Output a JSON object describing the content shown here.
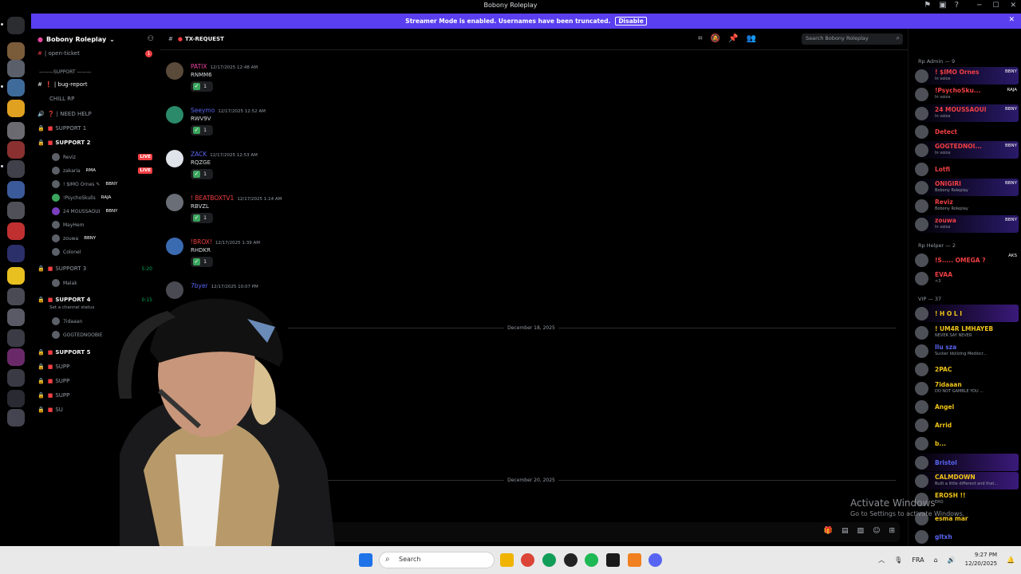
{
  "window": {
    "title": "Bobony Roleplay"
  },
  "banner": {
    "text": "Streamer Mode is enabled. Usernames have been truncated.",
    "disable_label": "Disable"
  },
  "server": {
    "name": "Bobony Roleplay"
  },
  "sidebar": {
    "channels": [
      {
        "label": "| open-ticket",
        "badge": "1"
      },
      {
        "label": "———SUPPORT ———",
        "category": true
      },
      {
        "label": "❗ | bug-report"
      },
      {
        "label": "CHILL RP"
      },
      {
        "label": "❓ | NEED HELP"
      },
      {
        "label": "SUPPORT 1"
      },
      {
        "label": "SUPPORT 2"
      },
      {
        "label": "SUPPORT 3",
        "timer": "5:20"
      },
      {
        "label": "SUPPORT 4",
        "timer": "0:15",
        "status": "Set a channel status"
      }
    ],
    "voice_support2": [
      {
        "name": "Reviz",
        "live": "LIVE"
      },
      {
        "name": "zakaria",
        "tag": "RMA",
        "live": "LIVE"
      },
      {
        "name": "! $IMO Ornes ✎",
        "tag": "BBNY"
      },
      {
        "name": "!PsychoSkulls",
        "tag": "RAJA"
      },
      {
        "name": "24 MOUSSAOUI",
        "tag": "BBNY"
      },
      {
        "name": "MayHem"
      },
      {
        "name": "zouwa",
        "tag": "BBNY"
      },
      {
        "name": "Colonel"
      }
    ],
    "voice_support3": [
      {
        "name": "Malak"
      }
    ],
    "voice_support4": [
      {
        "name": "7idaaan"
      },
      {
        "name": "GOGTEDNOOBIE"
      }
    ],
    "more_channels": [
      "SUPPORT 5",
      "SUPP",
      "SUPP",
      "SUPP",
      "SU"
    ]
  },
  "channel": {
    "name": "TX-REQUEST"
  },
  "search": {
    "placeholder": "Search Bobony Roleplay"
  },
  "messages": [
    {
      "user": "PATIX",
      "time": "12/17/2025 12:48 AM",
      "text": "RNMM6",
      "reaction_count": "1"
    },
    {
      "user": "Seeymo",
      "time": "12/17/2025 12:52 AM",
      "text": "RWV9V",
      "reaction_count": "1"
    },
    {
      "user": "ZACK",
      "time": "12/17/2025 12:53 AM",
      "text": "RQZGE",
      "reaction_count": "1"
    },
    {
      "user": "! BEATBOXTV1",
      "time": "12/17/2025 1:14 AM",
      "text": "RBVZL",
      "reaction_count": "1"
    },
    {
      "user": "!BROX!",
      "time": "12/17/2025 1:39 AM",
      "text": "RHDKR",
      "reaction_count": "1"
    },
    {
      "user": "7byer",
      "time": "12/17/2025 10:07 PM",
      "text": "",
      "reaction_count": ""
    }
  ],
  "dividers": [
    "December 18, 2025",
    "December 20, 2025"
  ],
  "members": {
    "groups": [
      {
        "header": "Rp Admin — 9",
        "items": [
          {
            "name": "! $IMO Ornes",
            "status": "In voice",
            "tag": "BBNY",
            "color": "#f23f43"
          },
          {
            "name": "!PsychoSku...",
            "status": "In voice",
            "tag": "RAJA",
            "color": "#f23f43"
          },
          {
            "name": "24 MOUSSAOUI",
            "status": "In voice",
            "tag": "BBNY",
            "color": "#f23f43"
          },
          {
            "name": "Detect",
            "status": "",
            "tag": "",
            "color": "#f23f43"
          },
          {
            "name": "GOGTEDNOI...",
            "status": "In voice",
            "tag": "BBNY",
            "color": "#f23f43"
          },
          {
            "name": "Lotfi",
            "status": "",
            "tag": "",
            "color": "#f23f43"
          },
          {
            "name": "ONIGIRI",
            "status": "Bobony Roleplay",
            "tag": "BBNY",
            "color": "#f23f43"
          },
          {
            "name": "Reviz",
            "status": "Bobony Roleplay",
            "tag": "",
            "color": "#f23f43"
          },
          {
            "name": "zouwa",
            "status": "In voice",
            "tag": "BBNY",
            "color": "#f23f43"
          }
        ]
      },
      {
        "header": "Rp Helper — 2",
        "items": [
          {
            "name": "!S..... OMEGA ?",
            "status": "",
            "tag": "AKS",
            "color": "#f23f43"
          },
          {
            "name": "EVAA",
            "status": "<3",
            "tag": "",
            "color": "#f23f43"
          }
        ]
      },
      {
        "header": "VIP — 37",
        "items": [
          {
            "name": "! H O L I",
            "status": "",
            "tag": "",
            "color": "#f0c419"
          },
          {
            "name": "! UM4R LMHAYEB",
            "status": "NEVER SAY NEVER",
            "tag": "",
            "color": "#f0c419"
          },
          {
            "name": "Ilu sza",
            "status": "Sucker Idolizing Mediocr...",
            "tag": "",
            "color": "#5865f2"
          },
          {
            "name": "2PAC",
            "status": "",
            "tag": "",
            "color": "#f0c419"
          },
          {
            "name": "7idaaan",
            "status": "DO NOT GAMBLE YOU ...",
            "tag": "",
            "color": "#f0c419"
          },
          {
            "name": "Angel",
            "status": "",
            "tag": "",
            "color": "#f0c419"
          },
          {
            "name": "Arrid",
            "status": "",
            "tag": "",
            "color": "#f0c419"
          },
          {
            "name": "b...",
            "status": "",
            "tag": "",
            "color": "#f0c419"
          },
          {
            "name": "Bristol",
            "status": "",
            "tag": "",
            "color": "#5865f2"
          },
          {
            "name": "CALMDOWN",
            "status": "Built a little different and that...",
            "tag": "",
            "color": "#f0c419"
          },
          {
            "name": "EROSH !!",
            "status": "ERO",
            "tag": "",
            "color": "#f0c419"
          },
          {
            "name": "esma mar",
            "status": "",
            "tag": "",
            "color": "#f0c419"
          },
          {
            "name": "gltxh",
            "status": "",
            "tag": "",
            "color": "#5865f2"
          }
        ]
      }
    ]
  },
  "watermark": {
    "line1": "Activate Windows",
    "line2": "Go to Settings to activate Windows."
  },
  "taskbar": {
    "search": "Search",
    "lang": "FRA",
    "time": "9:27 PM",
    "date": "12/20/2025"
  },
  "colors": {
    "banner": "#5a3ff0",
    "accent": "#5865f2",
    "live": "#f23f43",
    "online": "#00a85a"
  }
}
